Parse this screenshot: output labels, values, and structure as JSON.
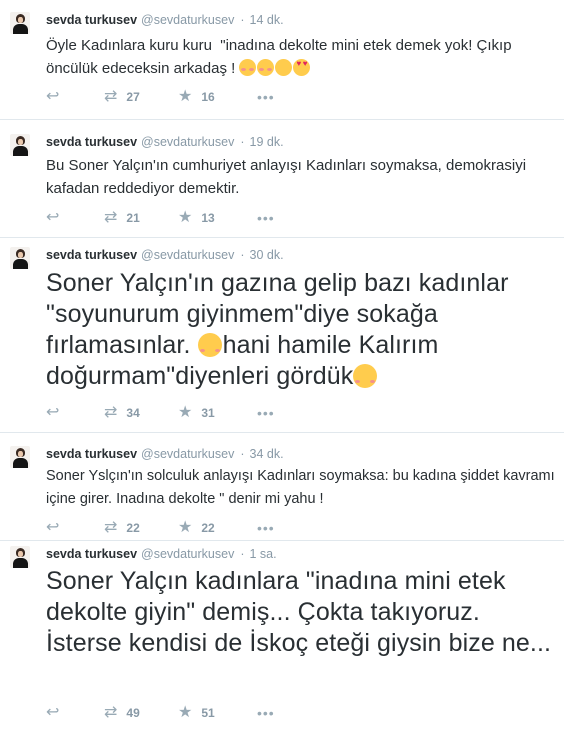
{
  "tweets": [
    {
      "name": "sevda turkusev",
      "handle": "@sevdaturkusev",
      "separator": "·",
      "time": "14 dk.",
      "text": "Öyle Kadınlara kuru kuru  \"inadına dekolte mini etek demek yok! Çıkıp öncülük edeceksin arkadaş ! ",
      "emojis": [
        "smiling-face-icon",
        "smiling-face-icon",
        "relieved-face-icon",
        "heart-eyes-face-icon"
      ],
      "retweets": "27",
      "favorites": "16"
    },
    {
      "name": "sevda turkusev",
      "handle": "@sevdaturkusev",
      "separator": "·",
      "time": "19 dk.",
      "text": "Bu Soner Yalçın'ın cumhuriyet anlayışı Kadınları soymaksa, demokrasiyi kafadan reddediyor demektir.",
      "retweets": "21",
      "favorites": "13"
    },
    {
      "name": "sevda turkusev",
      "handle": "@sevdaturkusev",
      "separator": "·",
      "time": "30 dk.",
      "text_part1": "Soner Yalçın'ın gazına gelip bazı kadınlar \"soyunurum giyinmem\"diye sokağa fırlamasınlar. ",
      "text_part2": "hani hamile Kalırım doğurmam\"diyenleri gördük",
      "retweets": "34",
      "favorites": "31"
    },
    {
      "name": "sevda turkusev",
      "handle": "@sevdaturkusev",
      "separator": "·",
      "time": "34 dk.",
      "text": "Soner Yslçın'ın solculuk anlayışı Kadınları soymaksa: bu kadına şiddet kavramı içine girer. Inadına dekolte \" denir mi yahu !",
      "retweets": "22",
      "favorites": "22"
    },
    {
      "name": "sevda turkusev",
      "handle": "@sevdaturkusev",
      "separator": "·",
      "time": "1 sa.",
      "text": "Soner Yalçın kadınlara \"inadına mini etek dekolte giyin\" demiş... Çokta takıyoruz. İsterse kendisi de İskoç eteği giysin bize ne...",
      "retweets": "49",
      "favorites": "51"
    }
  ],
  "icons": {
    "reply": "reply-arrow-icon",
    "retweet": "retweet-icon",
    "favorite": "star-icon",
    "more": "more-dots-icon"
  },
  "colors": {
    "text": "#292f33",
    "muted": "#8899a6",
    "icon": "#99aab5",
    "divider": "#e1e8ed"
  }
}
